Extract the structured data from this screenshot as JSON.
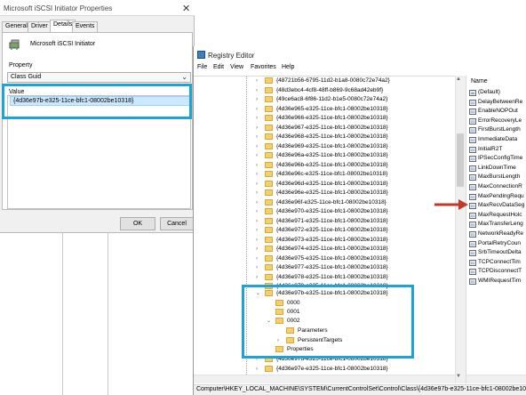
{
  "props_dialog": {
    "title": "Microsoft iSCSI Initiator Properties",
    "tabs": [
      "General",
      "Driver",
      "Details",
      "Events"
    ],
    "active_tab": "Details",
    "device_name": "Microsoft iSCSI Initiator",
    "property_label": "Property",
    "property_value": "Class Guid",
    "value_label": "Value",
    "value": "{4d36e97b-e325-11ce-bfc1-08002be10318}",
    "ok": "OK",
    "cancel": "Cancel"
  },
  "registry": {
    "title": "Registry Editor",
    "menu": [
      "File",
      "Edit",
      "View",
      "Favorites",
      "Help"
    ],
    "tree_keys": [
      "{48721b56-6795-11d2-b1a8-0080c72e74a2}",
      "{48d3ebc4-4cf8-48ff-b869-9c68ad42eb9f}",
      "{49ce6ac8-6f86-11d2-b1e5-0080c72e74a2}",
      "{4d36e965-e325-11ce-bfc1-08002be10318}",
      "{4d36e966-e325-11ce-bfc1-08002be10318}",
      "{4d36e967-e325-11ce-bfc1-08002be10318}",
      "{4d36e968-e325-11ce-bfc1-08002be10318}",
      "{4d36e969-e325-11ce-bfc1-08002be10318}",
      "{4d36e96a-e325-11ce-bfc1-08002be10318}",
      "{4d36e96b-e325-11ce-bfc1-08002be10318}",
      "{4d36e96c-e325-11ce-bfc1-08002be10318}",
      "{4d36e96d-e325-11ce-bfc1-08002be10318}",
      "{4d36e96e-e325-11ce-bfc1-08002be10318}",
      "{4d36e96f-e325-11ce-bfc1-08002be10318}",
      "{4d36e970-e325-11ce-bfc1-08002be10318}",
      "{4d36e971-e325-11ce-bfc1-08002be10318}",
      "{4d36e972-e325-11ce-bfc1-08002be10318}",
      "{4d36e973-e325-11ce-bfc1-08002be10318}",
      "{4d36e974-e325-11ce-bfc1-08002be10318}",
      "{4d36e975-e325-11ce-bfc1-08002be10318}",
      "{4d36e977-e325-11ce-bfc1-08002be10318}",
      "{4d36e978-e325-11ce-bfc1-08002be10318}",
      "{4d36e979-e325-11ce-bfc1-08002be10318}"
    ],
    "expanded_key": "{4d36e97b-e325-11ce-bfc1-08002be10318}",
    "subkeys": [
      "0000",
      "0001",
      "0002",
      "Parameters",
      "PersistentTargets",
      "Properties"
    ],
    "after_keys": [
      "{4d36e97d-e325-11ce-bfc1-08002be10318}",
      "{4d36e97e-e325-11ce-bfc1-08002be10318}",
      "{4d36e980-e325-11ce-bfc1-08002be10318}"
    ],
    "name_header": "Name",
    "values": [
      "(Default)",
      "DelayBetweenRe",
      "EnableNOPOut",
      "ErrorRecoveryLe",
      "FirstBurstLength",
      "ImmediateData",
      "InitialR2T",
      "IPSecConfigTime",
      "LinkDownTime",
      "MaxBurstLength",
      "MaxConnectionR",
      "MaxPendingRequ",
      "MaxRecvDataSeg",
      "MaxRequestHolc",
      "MaxTransferLeng",
      "NetworkReadyRe",
      "PortalRetryCoun",
      "SrbTimeoutDelta",
      "TCPConnectTim",
      "TCPDisconnectT",
      "WMIRequestTim"
    ],
    "status_path": "Computer\\HKEY_LOCAL_MACHINE\\SYSTEM\\CurrentControlSet\\Control\\Class\\{4d36e97b-e325-11ce-bfc1-08002be10318}\\0"
  },
  "colors": {
    "highlight": "#1ea3d8",
    "arrow": "#c0392b",
    "folder": "#f6cf6a"
  }
}
